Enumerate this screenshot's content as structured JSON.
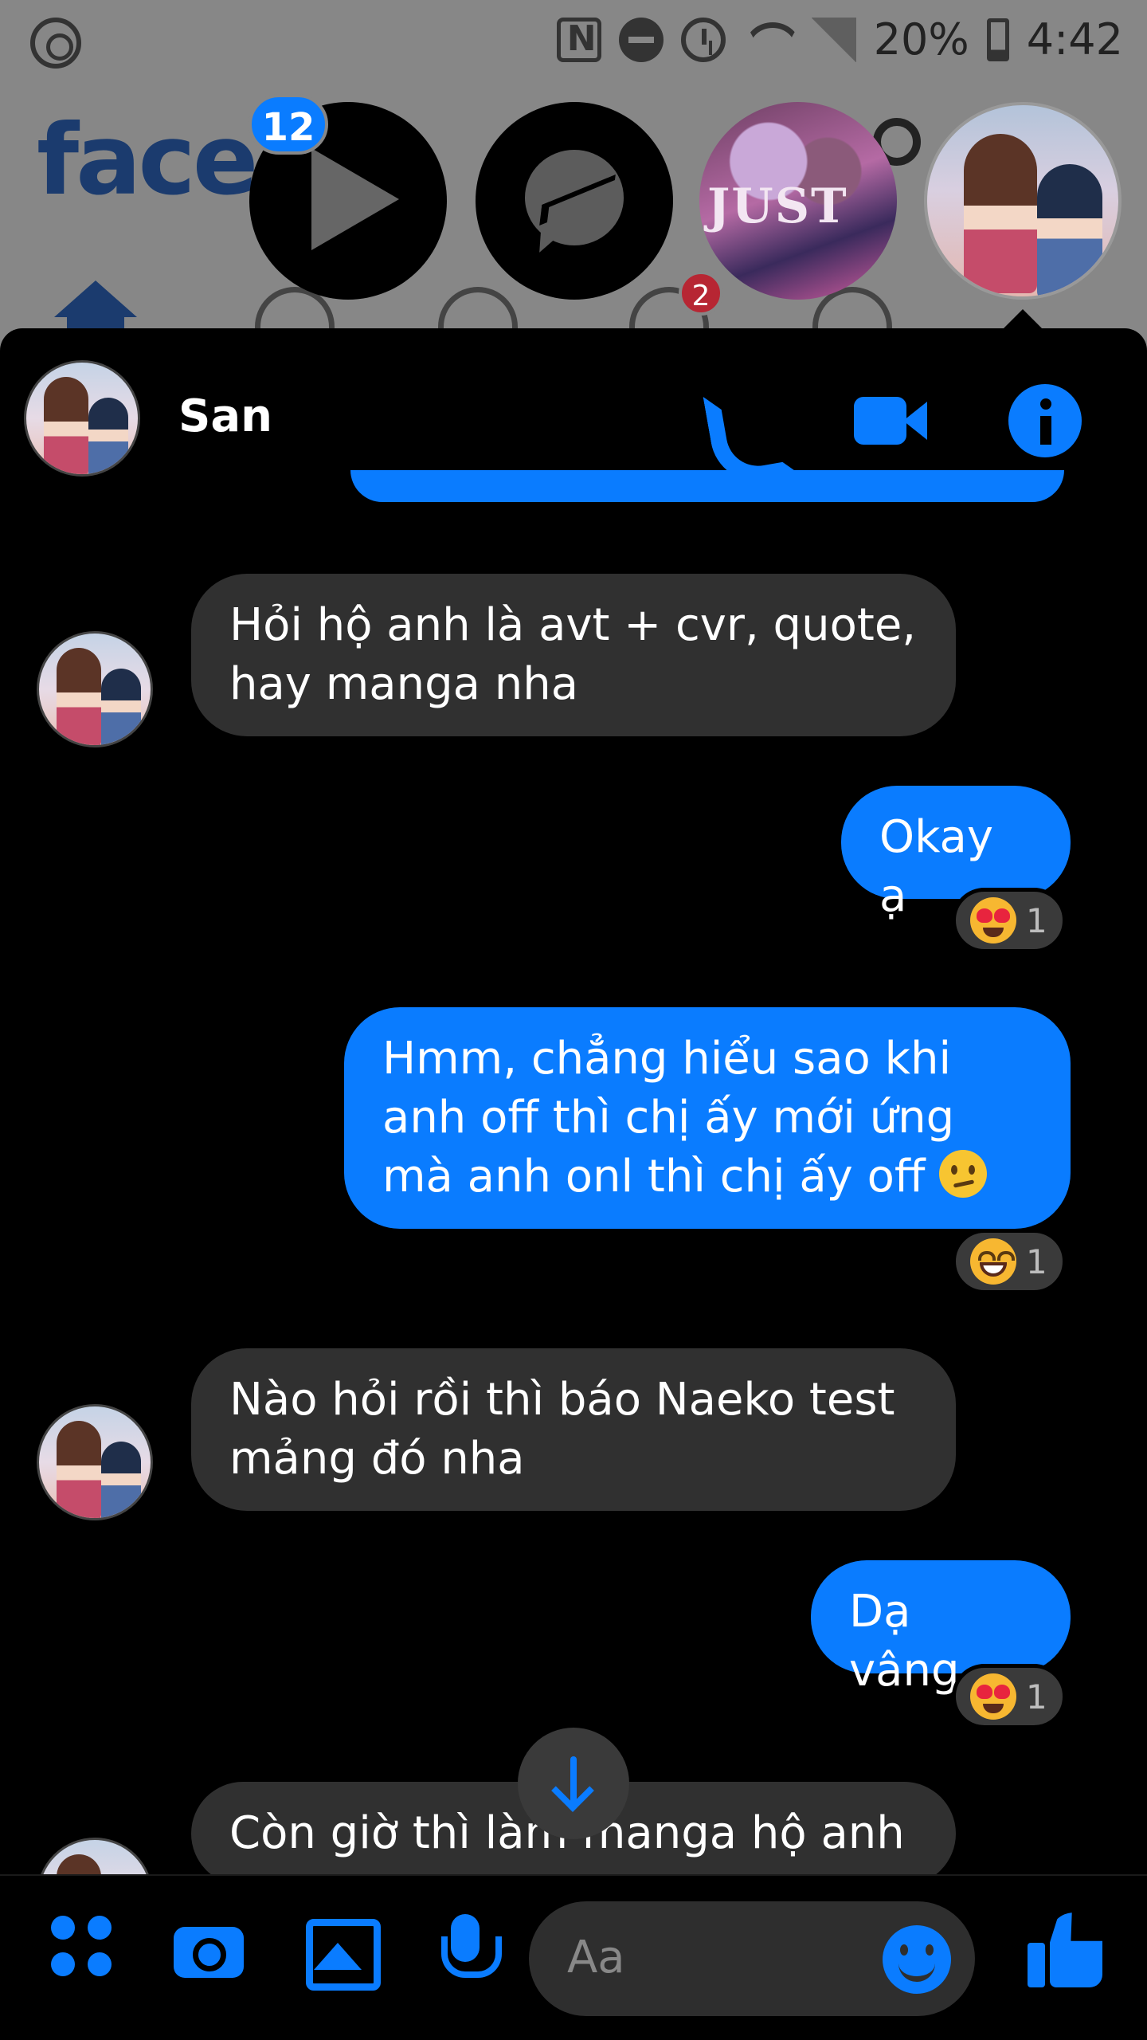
{
  "status_bar": {
    "battery": "20%",
    "time": "4:42"
  },
  "facebook_bg": {
    "logo_text": "faceb",
    "video_badge": "2"
  },
  "chat_heads": {
    "badge_count": "12",
    "art_text": "JUST"
  },
  "chat": {
    "contact_name": "San",
    "messages": [
      {
        "dir": "in",
        "text": "Hỏi hộ anh là avt + cvr, quote, hay manga nha"
      },
      {
        "dir": "out",
        "text": "Okay ạ",
        "reaction": {
          "emoji": "heart-eyes",
          "count": "1"
        }
      },
      {
        "dir": "out",
        "text": "Hmm, chẳng hiểu sao khi anh off thì chị ấy mới ứng mà anh onl thì chị ấy off",
        "reaction": {
          "emoji": "laughing",
          "count": "1"
        }
      },
      {
        "dir": "in",
        "text": "Nào hỏi rồi thì báo Naeko test mảng đó nha"
      },
      {
        "dir": "out",
        "text": "Dạ vâng",
        "reaction": {
          "emoji": "heart-eyes",
          "count": "1"
        }
      },
      {
        "dir": "in",
        "text": "Còn giờ thì làm manga hộ anh"
      }
    ]
  },
  "composer": {
    "placeholder": "Aa"
  },
  "colors": {
    "accent": "#0a7cff",
    "incoming_bubble": "#303030",
    "background": "#000000"
  }
}
